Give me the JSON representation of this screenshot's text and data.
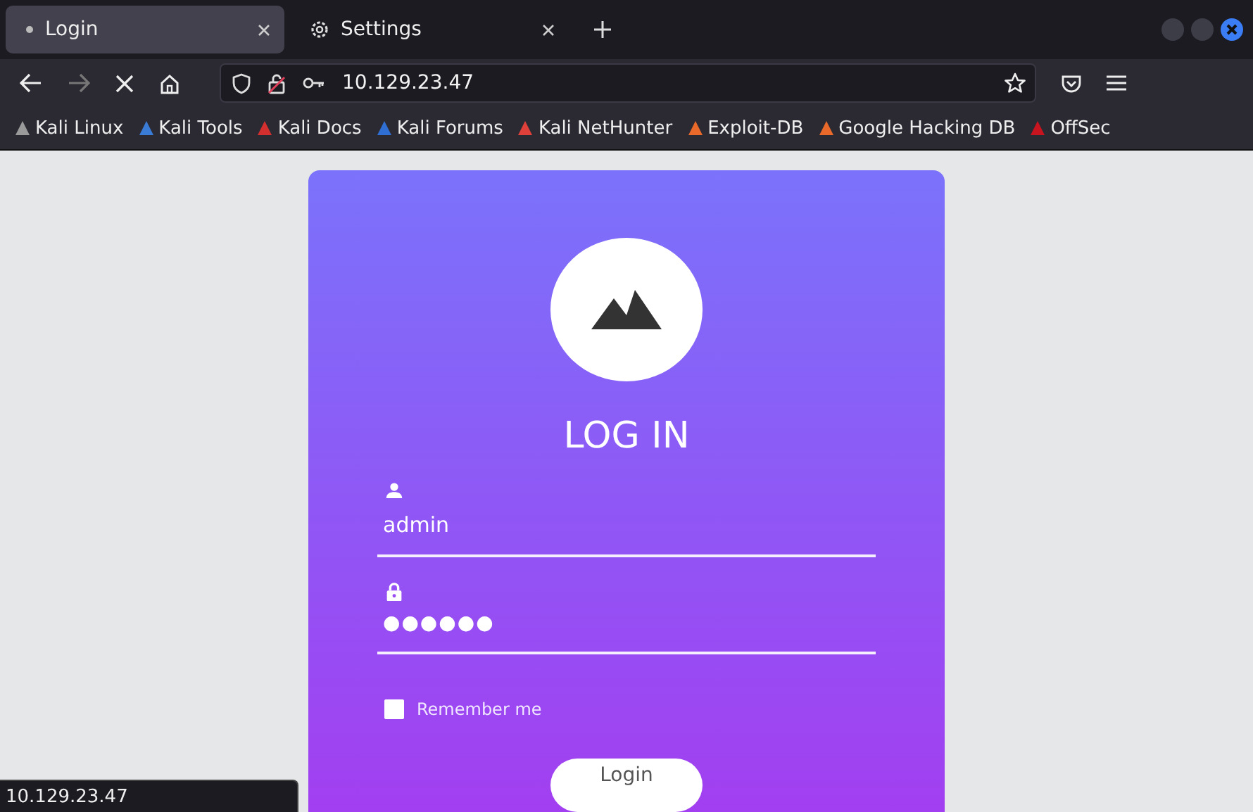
{
  "tabs": [
    {
      "label": "Login",
      "selected": true,
      "kind": "page"
    },
    {
      "label": "Settings",
      "selected": false,
      "kind": "settings"
    }
  ],
  "address": "10.129.23.47",
  "bookmarks": [
    {
      "label": "Kali Linux",
      "color": "#9a9a9a"
    },
    {
      "label": "Kali Tools",
      "color": "#3a7bd5"
    },
    {
      "label": "Kali Docs",
      "color": "#d32f2f"
    },
    {
      "label": "Kali Forums",
      "color": "#2f6fd3"
    },
    {
      "label": "Kali NetHunter",
      "color": "#e0403a"
    },
    {
      "label": "Exploit-DB",
      "color": "#e8692a"
    },
    {
      "label": "Google Hacking DB",
      "color": "#e8692a"
    },
    {
      "label": "OffSec",
      "color": "#c8141e"
    }
  ],
  "login": {
    "title": "LOG IN",
    "username": "admin",
    "password": "●●●●●●",
    "remember": {
      "label": "Remember me",
      "checked": false
    },
    "button": "Login"
  },
  "status_bar": "10.129.23.47"
}
